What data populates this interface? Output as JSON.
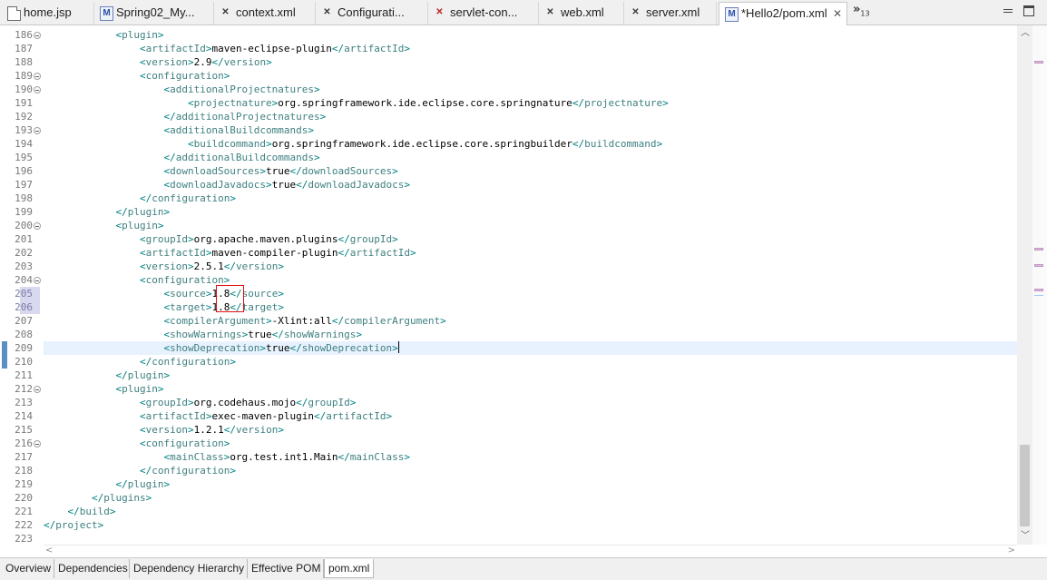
{
  "tabs": [
    {
      "label": "home.jsp",
      "icon": "jsp-file-icon"
    },
    {
      "label": "Spring02_My...",
      "icon": "maven-file-icon"
    },
    {
      "label": "context.xml",
      "icon": "xml-file-icon"
    },
    {
      "label": "Configurati...",
      "icon": "xml-file-icon"
    },
    {
      "label": "servlet-con...",
      "icon": "xml-error-file-icon"
    },
    {
      "label": "web.xml",
      "icon": "xml-file-icon"
    },
    {
      "label": "server.xml",
      "icon": "xml-file-icon"
    },
    {
      "label": "*Hello2/pom.xml",
      "icon": "maven-file-icon",
      "active": true
    }
  ],
  "overflow": {
    "symbol": "»",
    "count": "13"
  },
  "first_line": 186,
  "current_line": 209,
  "highlighted_lines": [
    205,
    206
  ],
  "fold_lines": [
    186,
    189,
    190,
    193,
    200,
    204,
    212,
    216
  ],
  "lines": [
    [
      [
        "t",
        "            "
      ],
      [
        "b",
        "<"
      ],
      [
        "g",
        "plugin"
      ],
      [
        "b",
        ">"
      ]
    ],
    [
      [
        "t",
        "                "
      ],
      [
        "b",
        "<"
      ],
      [
        "g",
        "artifactId"
      ],
      [
        "b",
        ">"
      ],
      [
        "t",
        "maven-eclipse-plugin"
      ],
      [
        "b",
        "</"
      ],
      [
        "g",
        "artifactId"
      ],
      [
        "b",
        ">"
      ]
    ],
    [
      [
        "t",
        "                "
      ],
      [
        "b",
        "<"
      ],
      [
        "g",
        "version"
      ],
      [
        "b",
        ">"
      ],
      [
        "t",
        "2.9"
      ],
      [
        "b",
        "</"
      ],
      [
        "g",
        "version"
      ],
      [
        "b",
        ">"
      ]
    ],
    [
      [
        "t",
        "                "
      ],
      [
        "b",
        "<"
      ],
      [
        "g",
        "configuration"
      ],
      [
        "b",
        ">"
      ]
    ],
    [
      [
        "t",
        "                    "
      ],
      [
        "b",
        "<"
      ],
      [
        "g",
        "additionalProjectnatures"
      ],
      [
        "b",
        ">"
      ]
    ],
    [
      [
        "t",
        "                        "
      ],
      [
        "b",
        "<"
      ],
      [
        "g",
        "projectnature"
      ],
      [
        "b",
        ">"
      ],
      [
        "t",
        "org.springframework.ide.eclipse.core.springnature"
      ],
      [
        "b",
        "</"
      ],
      [
        "g",
        "projectnature"
      ],
      [
        "b",
        ">"
      ]
    ],
    [
      [
        "t",
        "                    "
      ],
      [
        "b",
        "</"
      ],
      [
        "g",
        "additionalProjectnatures"
      ],
      [
        "b",
        ">"
      ]
    ],
    [
      [
        "t",
        "                    "
      ],
      [
        "b",
        "<"
      ],
      [
        "g",
        "additionalBuildcommands"
      ],
      [
        "b",
        ">"
      ]
    ],
    [
      [
        "t",
        "                        "
      ],
      [
        "b",
        "<"
      ],
      [
        "g",
        "buildcommand"
      ],
      [
        "b",
        ">"
      ],
      [
        "t",
        "org.springframework.ide.eclipse.core.springbuilder"
      ],
      [
        "b",
        "</"
      ],
      [
        "g",
        "buildcommand"
      ],
      [
        "b",
        ">"
      ]
    ],
    [
      [
        "t",
        "                    "
      ],
      [
        "b",
        "</"
      ],
      [
        "g",
        "additionalBuildcommands"
      ],
      [
        "b",
        ">"
      ]
    ],
    [
      [
        "t",
        "                    "
      ],
      [
        "b",
        "<"
      ],
      [
        "g",
        "downloadSources"
      ],
      [
        "b",
        ">"
      ],
      [
        "t",
        "true"
      ],
      [
        "b",
        "</"
      ],
      [
        "g",
        "downloadSources"
      ],
      [
        "b",
        ">"
      ]
    ],
    [
      [
        "t",
        "                    "
      ],
      [
        "b",
        "<"
      ],
      [
        "g",
        "downloadJavadocs"
      ],
      [
        "b",
        ">"
      ],
      [
        "t",
        "true"
      ],
      [
        "b",
        "</"
      ],
      [
        "g",
        "downloadJavadocs"
      ],
      [
        "b",
        ">"
      ]
    ],
    [
      [
        "t",
        "                "
      ],
      [
        "b",
        "</"
      ],
      [
        "g",
        "configuration"
      ],
      [
        "b",
        ">"
      ]
    ],
    [
      [
        "t",
        "            "
      ],
      [
        "b",
        "</"
      ],
      [
        "g",
        "plugin"
      ],
      [
        "b",
        ">"
      ]
    ],
    [
      [
        "t",
        "            "
      ],
      [
        "b",
        "<"
      ],
      [
        "g",
        "plugin"
      ],
      [
        "b",
        ">"
      ]
    ],
    [
      [
        "t",
        "                "
      ],
      [
        "b",
        "<"
      ],
      [
        "g",
        "groupId"
      ],
      [
        "b",
        ">"
      ],
      [
        "t",
        "org.apache.maven.plugins"
      ],
      [
        "b",
        "</"
      ],
      [
        "g",
        "groupId"
      ],
      [
        "b",
        ">"
      ]
    ],
    [
      [
        "t",
        "                "
      ],
      [
        "b",
        "<"
      ],
      [
        "g",
        "artifactId"
      ],
      [
        "b",
        ">"
      ],
      [
        "t",
        "maven-compiler-plugin"
      ],
      [
        "b",
        "</"
      ],
      [
        "g",
        "artifactId"
      ],
      [
        "b",
        ">"
      ]
    ],
    [
      [
        "t",
        "                "
      ],
      [
        "b",
        "<"
      ],
      [
        "g",
        "version"
      ],
      [
        "b",
        ">"
      ],
      [
        "t",
        "2.5.1"
      ],
      [
        "b",
        "</"
      ],
      [
        "g",
        "version"
      ],
      [
        "b",
        ">"
      ]
    ],
    [
      [
        "t",
        "                "
      ],
      [
        "b",
        "<"
      ],
      [
        "g",
        "configuration"
      ],
      [
        "b",
        ">"
      ]
    ],
    [
      [
        "t",
        "                    "
      ],
      [
        "b",
        "<"
      ],
      [
        "g",
        "source"
      ],
      [
        "b",
        ">"
      ],
      [
        "t",
        "1.8"
      ],
      [
        "b",
        "</"
      ],
      [
        "g",
        "source"
      ],
      [
        "b",
        ">"
      ]
    ],
    [
      [
        "t",
        "                    "
      ],
      [
        "b",
        "<"
      ],
      [
        "g",
        "target"
      ],
      [
        "b",
        ">"
      ],
      [
        "t",
        "1.8"
      ],
      [
        "b",
        "</"
      ],
      [
        "g",
        "target"
      ],
      [
        "b",
        ">"
      ]
    ],
    [
      [
        "t",
        "                    "
      ],
      [
        "b",
        "<"
      ],
      [
        "g",
        "compilerArgument"
      ],
      [
        "b",
        ">"
      ],
      [
        "t",
        "-Xlint:all"
      ],
      [
        "b",
        "</"
      ],
      [
        "g",
        "compilerArgument"
      ],
      [
        "b",
        ">"
      ]
    ],
    [
      [
        "t",
        "                    "
      ],
      [
        "b",
        "<"
      ],
      [
        "g",
        "showWarnings"
      ],
      [
        "b",
        ">"
      ],
      [
        "t",
        "true"
      ],
      [
        "b",
        "</"
      ],
      [
        "g",
        "showWarnings"
      ],
      [
        "b",
        ">"
      ]
    ],
    [
      [
        "t",
        "                    "
      ],
      [
        "b",
        "<"
      ],
      [
        "g",
        "showDeprecation"
      ],
      [
        "b",
        ">"
      ],
      [
        "t",
        "true"
      ],
      [
        "b",
        "</"
      ],
      [
        "g",
        "showDeprecation"
      ],
      [
        "b",
        ">"
      ]
    ],
    [
      [
        "t",
        "                "
      ],
      [
        "b",
        "</"
      ],
      [
        "g",
        "configuration"
      ],
      [
        "b",
        ">"
      ]
    ],
    [
      [
        "t",
        "            "
      ],
      [
        "b",
        "</"
      ],
      [
        "g",
        "plugin"
      ],
      [
        "b",
        ">"
      ]
    ],
    [
      [
        "t",
        "            "
      ],
      [
        "b",
        "<"
      ],
      [
        "g",
        "plugin"
      ],
      [
        "b",
        ">"
      ]
    ],
    [
      [
        "t",
        "                "
      ],
      [
        "b",
        "<"
      ],
      [
        "g",
        "groupId"
      ],
      [
        "b",
        ">"
      ],
      [
        "t",
        "org.codehaus.mojo"
      ],
      [
        "b",
        "</"
      ],
      [
        "g",
        "groupId"
      ],
      [
        "b",
        ">"
      ]
    ],
    [
      [
        "t",
        "                "
      ],
      [
        "b",
        "<"
      ],
      [
        "g",
        "artifactId"
      ],
      [
        "b",
        ">"
      ],
      [
        "t",
        "exec-maven-plugin"
      ],
      [
        "b",
        "</"
      ],
      [
        "g",
        "artifactId"
      ],
      [
        "b",
        ">"
      ]
    ],
    [
      [
        "t",
        "                "
      ],
      [
        "b",
        "<"
      ],
      [
        "g",
        "version"
      ],
      [
        "b",
        ">"
      ],
      [
        "t",
        "1.2.1"
      ],
      [
        "b",
        "</"
      ],
      [
        "g",
        "version"
      ],
      [
        "b",
        ">"
      ]
    ],
    [
      [
        "t",
        "                "
      ],
      [
        "b",
        "<"
      ],
      [
        "g",
        "configuration"
      ],
      [
        "b",
        ">"
      ]
    ],
    [
      [
        "t",
        "                    "
      ],
      [
        "b",
        "<"
      ],
      [
        "g",
        "mainClass"
      ],
      [
        "b",
        ">"
      ],
      [
        "t",
        "org.test.int1.Main"
      ],
      [
        "b",
        "</"
      ],
      [
        "g",
        "mainClass"
      ],
      [
        "b",
        ">"
      ]
    ],
    [
      [
        "t",
        "                "
      ],
      [
        "b",
        "</"
      ],
      [
        "g",
        "configuration"
      ],
      [
        "b",
        ">"
      ]
    ],
    [
      [
        "t",
        "            "
      ],
      [
        "b",
        "</"
      ],
      [
        "g",
        "plugin"
      ],
      [
        "b",
        ">"
      ]
    ],
    [
      [
        "t",
        "        "
      ],
      [
        "b",
        "</"
      ],
      [
        "g",
        "plugins"
      ],
      [
        "b",
        ">"
      ]
    ],
    [
      [
        "t",
        "    "
      ],
      [
        "b",
        "</"
      ],
      [
        "g",
        "build"
      ],
      [
        "b",
        ">"
      ]
    ],
    [
      [
        "b",
        "</"
      ],
      [
        "g",
        "project"
      ],
      [
        "b",
        ">"
      ]
    ],
    []
  ],
  "bottom_tabs": [
    {
      "label": "Overview"
    },
    {
      "label": "Dependencies"
    },
    {
      "label": "Dependency Hierarchy"
    },
    {
      "label": "Effective POM"
    },
    {
      "label": "pom.xml",
      "active": true
    }
  ],
  "colors": {
    "tag": "#3f7f7f",
    "bracket": "#008080",
    "text": "#000000",
    "current_line": "#e8f2fe",
    "highlight_box": "#e01010"
  }
}
